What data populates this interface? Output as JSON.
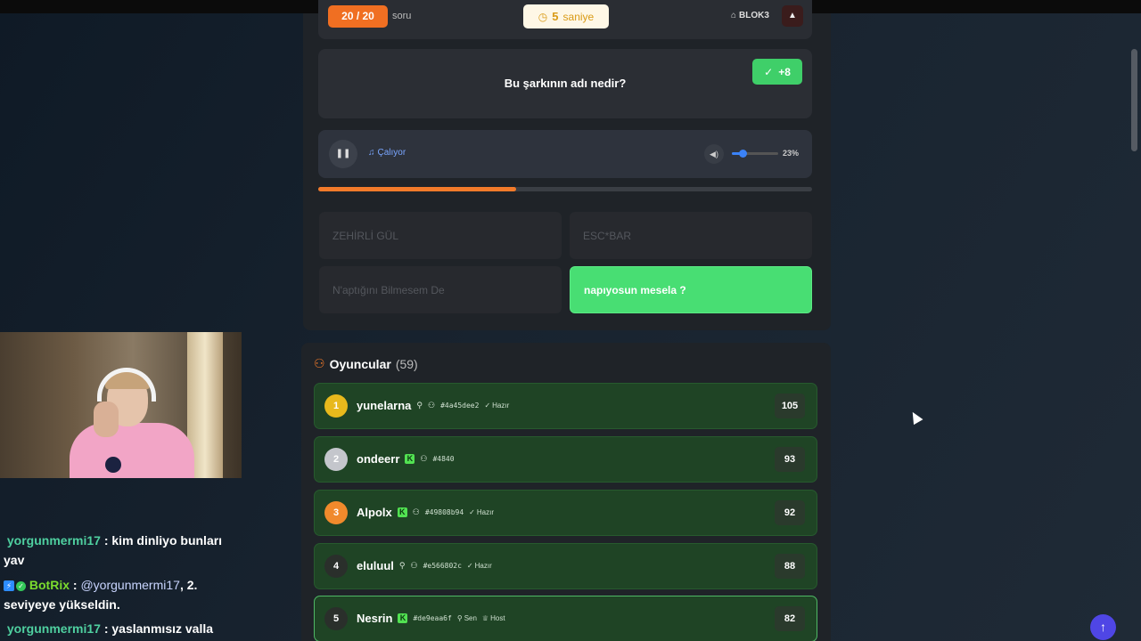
{
  "quiz": {
    "question_counter": "20 / 20",
    "question_unit": "soru",
    "timer_value": "5",
    "timer_unit": "saniye",
    "room_tag": "BLOK3",
    "question_text": "Bu şarkının adı nedir?",
    "points_awarded": "+8",
    "progress": 0.4
  },
  "audio": {
    "status": "Çalıyor",
    "volume_percent_label": "23%",
    "volume": 0.23
  },
  "answers": [
    {
      "label": "ZEHİRLİ GÜL",
      "correct": false
    },
    {
      "label": "ESC*BAR",
      "correct": false
    },
    {
      "label": "N'aptığını Bilmesem De",
      "correct": false
    },
    {
      "label": "napıyosun mesela ?",
      "correct": true
    }
  ],
  "players": {
    "title": "Oyuncular",
    "count": "(59)",
    "rows": [
      {
        "rank": "1",
        "name": "yunelarna",
        "id": "#4a45dee2",
        "status": "Hazır",
        "score": "105",
        "rank_color": "#e8b91c"
      },
      {
        "rank": "2",
        "name": "ondeerr",
        "id": "#4840",
        "status": "",
        "score": "93",
        "rank_color": "#c4c6cc"
      },
      {
        "rank": "3",
        "name": "Alpolx",
        "id": "#49808b94",
        "status": "Hazır",
        "score": "92",
        "rank_color": "#f08a2c"
      },
      {
        "rank": "4",
        "name": "eluluul",
        "id": "#e566802c",
        "status": "Hazır",
        "score": "88",
        "rank_color": "#2a2f2b"
      },
      {
        "rank": "5",
        "name": "Nesrin",
        "id": "#de9eaa6f",
        "you_label": "Sen",
        "host_label": "Host",
        "score": "82",
        "rank_color": "#2a2f2b"
      }
    ]
  },
  "chat": [
    {
      "user": "yorgunmermi17",
      "sep": " : ",
      "text": "kim dinliyo bunları yav"
    },
    {
      "user": "BotRix",
      "sep": " : ",
      "mention": "@yorgunmermi17",
      "text": ", 2. seviyeye yükseldin."
    },
    {
      "user": "yorgunmermi17",
      "sep": " : ",
      "text": "yaslanmısız valla"
    }
  ]
}
